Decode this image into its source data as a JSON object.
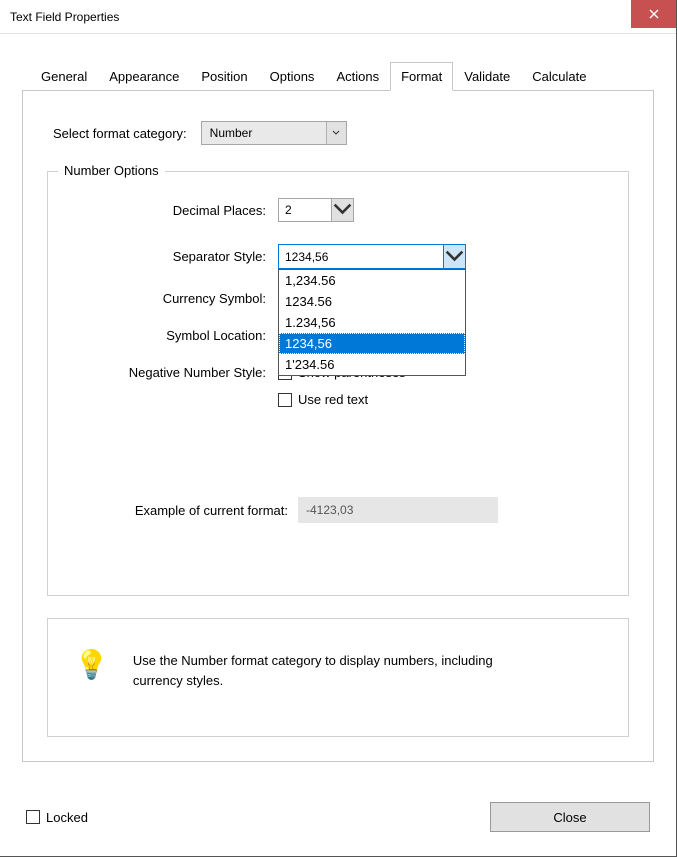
{
  "window": {
    "title": "Text Field Properties"
  },
  "tabs": [
    {
      "label": "General"
    },
    {
      "label": "Appearance"
    },
    {
      "label": "Position"
    },
    {
      "label": "Options"
    },
    {
      "label": "Actions"
    },
    {
      "label": "Format",
      "active": true
    },
    {
      "label": "Validate"
    },
    {
      "label": "Calculate"
    }
  ],
  "format": {
    "category_label": "Select format category:",
    "category_value": "Number",
    "fieldset_title": "Number Options",
    "decimal_label": "Decimal Places:",
    "decimal_value": "2",
    "separator_label": "Separator Style:",
    "separator_value": "1234,56",
    "separator_options": [
      {
        "label": "1,234.56"
      },
      {
        "label": "1234.56"
      },
      {
        "label": "1.234,56"
      },
      {
        "label": "1234,56",
        "selected": true
      },
      {
        "label": "1'234.56"
      }
    ],
    "currency_label": "Currency Symbol:",
    "symbol_loc_label": "Symbol Location:",
    "neg_label": "Negative Number Style:",
    "neg_option1": "Show parentheses",
    "neg_option2": "Use red text",
    "example_label": "Example of current format:",
    "example_value": "-4123,03",
    "info_text": "Use the Number format category to display numbers, including currency styles."
  },
  "footer": {
    "locked_label": "Locked",
    "close_label": "Close"
  }
}
